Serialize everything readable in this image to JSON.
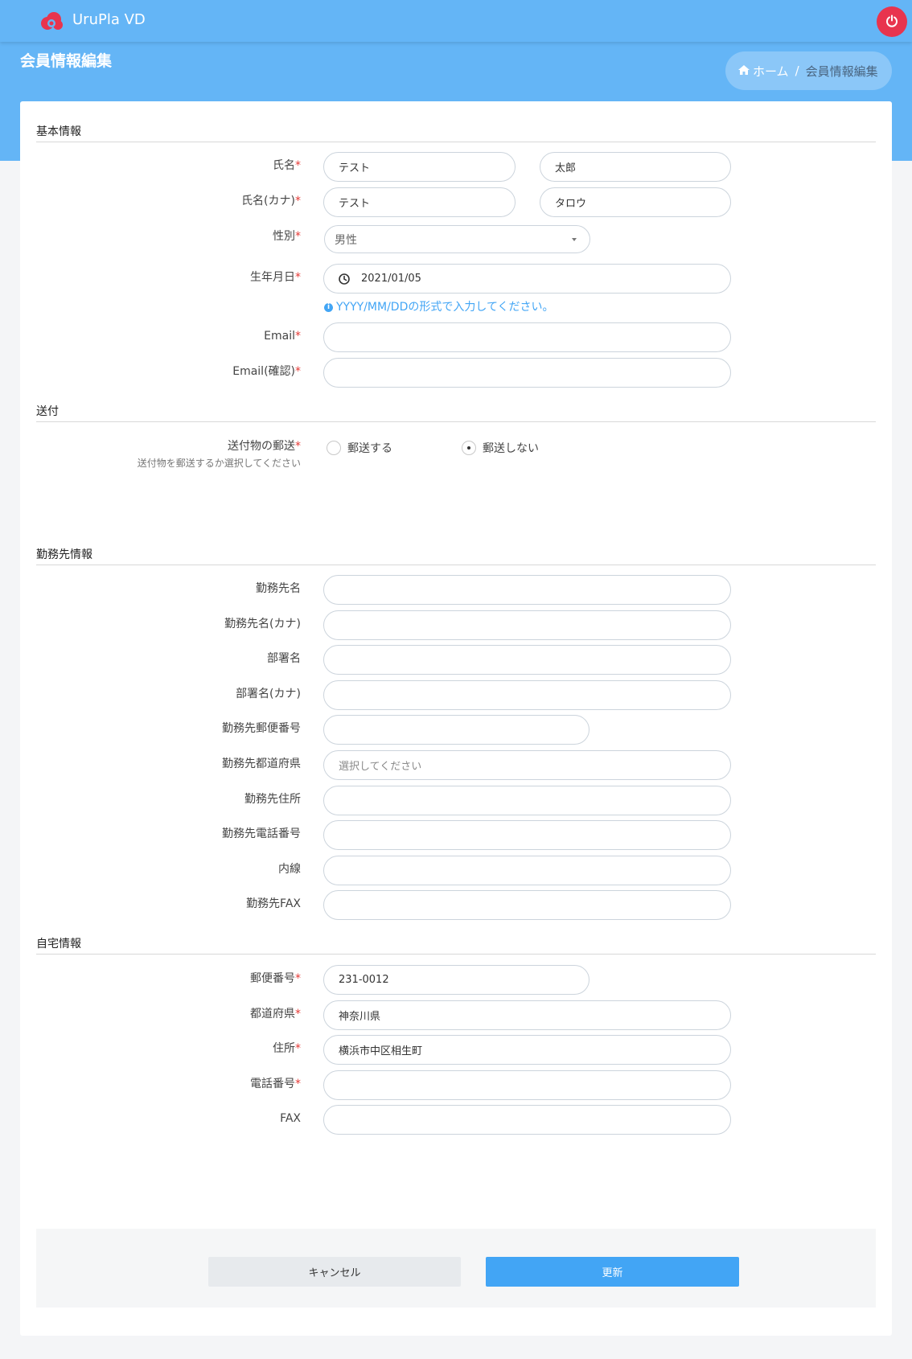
{
  "app": {
    "title": "UruPla VD",
    "brand_color": "#64b5f6",
    "power_color": "#e8344e"
  },
  "page": {
    "title": "会員情報編集"
  },
  "breadcrumb": {
    "home": "ホーム",
    "separator": "/",
    "current": "会員情報編集"
  },
  "basic": {
    "section": "基本情報",
    "name_label": "氏名",
    "last_name": "テスト",
    "first_name": "太郎",
    "kana_label": "氏名(カナ)",
    "last_kana": "テスト",
    "first_kana": "タロウ",
    "gender_label": "性別",
    "gender_value": "男性",
    "birth_label": "生年月日",
    "birth_value": "2021/01/05",
    "birth_hint": "YYYY/MM/DDの形式で入力してください。",
    "email_label": "Email",
    "email_value": "",
    "email_confirm_label": "Email(確認)",
    "email_confirm_value": ""
  },
  "shipping": {
    "section": "送付",
    "label": "送付物の郵送",
    "sublabel": "送付物を郵送するか選択してください",
    "options": [
      "郵送する",
      "郵送しない"
    ],
    "selected": "郵送しない"
  },
  "work": {
    "section": "勤務先情報",
    "name_label": "勤務先名",
    "name_kana_label": "勤務先名(カナ)",
    "dept_label": "部署名",
    "dept_kana_label": "部署名(カナ)",
    "zip_label": "勤務先郵便番号",
    "pref_label": "勤務先都道府県",
    "pref_placeholder": "選択してください",
    "address_label": "勤務先住所",
    "phone_label": "勤務先電話番号",
    "ext_label": "内線",
    "fax_label": "勤務先FAX"
  },
  "home": {
    "section": "自宅情報",
    "zip_label": "郵便番号",
    "zip_value": "231-0012",
    "pref_label": "都道府県",
    "pref_value": "神奈川県",
    "address_label": "住所",
    "address_value": "横浜市中区相生町",
    "phone_label": "電話番号",
    "phone_value": "",
    "fax_label": "FAX",
    "fax_value": ""
  },
  "actions": {
    "cancel": "キャンセル",
    "update": "更新"
  },
  "icons": {
    "logo": "cloud-logo-icon",
    "power": "power-icon",
    "home": "home-icon",
    "clock": "clock-icon",
    "info": "info-icon",
    "caret": "caret-down-icon"
  }
}
